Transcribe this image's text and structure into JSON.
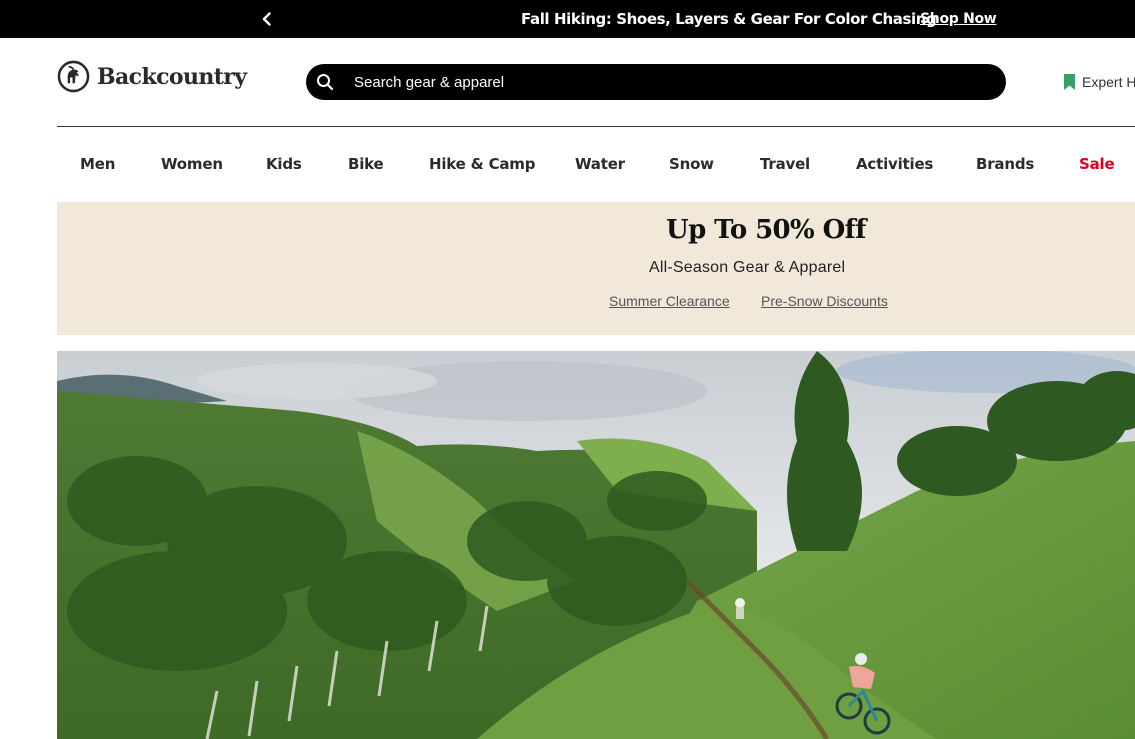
{
  "promo": {
    "prev_icon": "chevron-left-icon",
    "message": "Fall Hiking: Shoes, Layers & Gear For Color Chasing",
    "link_label": "Shop Now"
  },
  "header": {
    "logo_text": "Backcountry",
    "logo_icon": "goat-logo-icon",
    "search": {
      "icon": "search-icon",
      "placeholder": "Search gear & apparel"
    },
    "expert_label": "Expert H",
    "expert_icon": "bookmark-icon"
  },
  "nav": {
    "items": [
      "Men",
      "Women",
      "Kids",
      "Bike",
      "Hike & Camp",
      "Water",
      "Snow",
      "Travel",
      "Activities",
      "Brands",
      "Sale"
    ]
  },
  "banner": {
    "title": "Up To 50% Off",
    "subtitle": "All-Season Gear & Apparel",
    "links": [
      "Summer Clearance",
      "Pre-Snow Discounts"
    ]
  },
  "colors": {
    "promo_bg": "#000000",
    "banner_bg": "#f1e8da",
    "sale": "#e1001a",
    "expert_icon": "#3aa06a"
  }
}
